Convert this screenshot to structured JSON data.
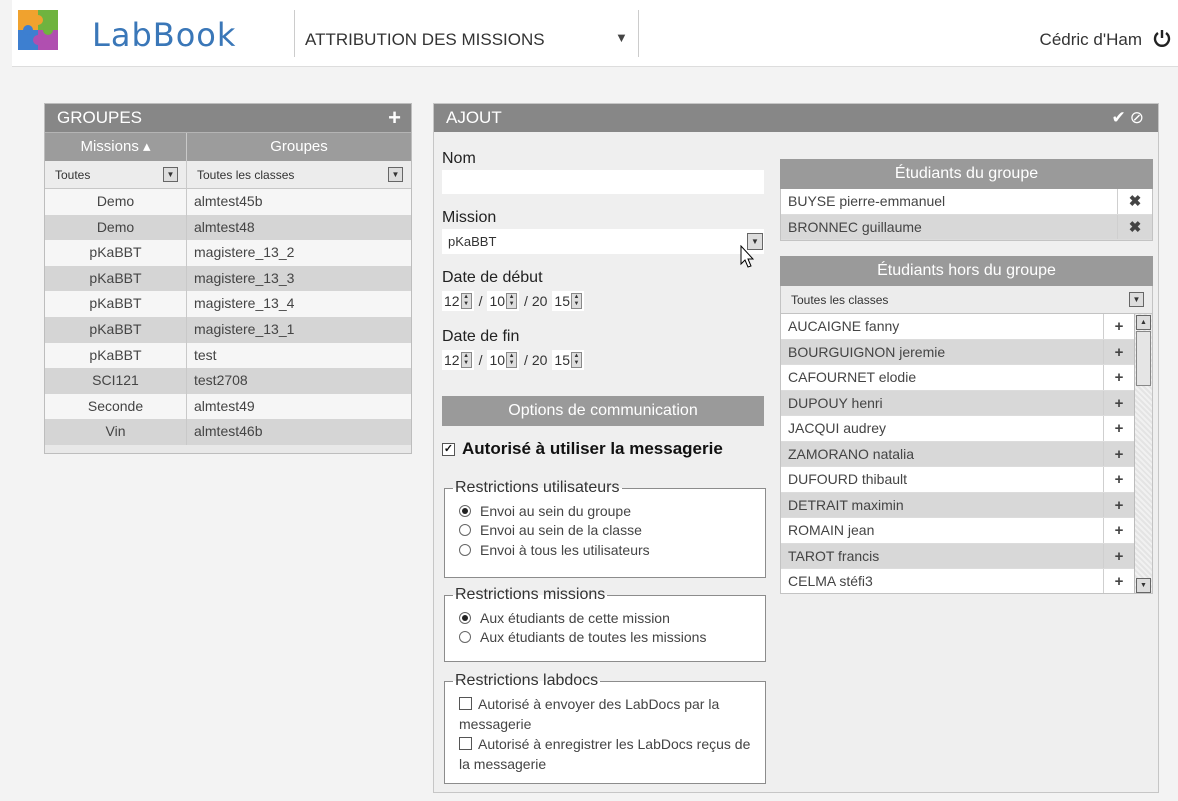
{
  "header": {
    "logo_text": "LabBook",
    "menu_title": "ATTRIBUTION DES MISSIONS",
    "username": "Cédric d'Ham"
  },
  "groups": {
    "title": "GROUPES",
    "col_missions": "Missions ▴",
    "col_groups": "Groupes",
    "filter_missions": "Toutes",
    "filter_groups": "Toutes les classes",
    "rows": [
      {
        "mission": "Demo",
        "group": "almtest45b"
      },
      {
        "mission": "Demo",
        "group": "almtest48"
      },
      {
        "mission": "pKaBBT",
        "group": "magistere_13_2"
      },
      {
        "mission": "pKaBBT",
        "group": "magistere_13_3"
      },
      {
        "mission": "pKaBBT",
        "group": "magistere_13_4"
      },
      {
        "mission": "pKaBBT",
        "group": "magistere_13_1"
      },
      {
        "mission": "pKaBBT",
        "group": "test"
      },
      {
        "mission": "SCI121",
        "group": "test2708"
      },
      {
        "mission": "Seconde",
        "group": "almtest49"
      },
      {
        "mission": "Vin",
        "group": "almtest46b"
      }
    ]
  },
  "ajout": {
    "title": "AJOUT",
    "nom_label": "Nom",
    "nom_value": "",
    "mission_label": "Mission",
    "mission_value": "pKaBBT",
    "start_label": "Date de début",
    "start": {
      "day": "12",
      "month": "10",
      "century": "/ 20",
      "year": "15"
    },
    "end_label": "Date de fin",
    "end": {
      "day": "12",
      "month": "10",
      "century": "/ 20",
      "year": "15"
    },
    "options_title": "Options de communication",
    "messaging_label": "Autorisé à utiliser la messagerie",
    "restr_users": {
      "legend": "Restrictions utilisateurs",
      "opts": [
        "Envoi au sein du groupe",
        "Envoi au sein de la classe",
        "Envoi à tous les utilisateurs"
      ]
    },
    "restr_missions": {
      "legend": "Restrictions missions",
      "opts": [
        "Aux étudiants de cette mission",
        "Aux étudiants de toutes les missions"
      ]
    },
    "restr_labdocs": {
      "legend": "Restrictions labdocs",
      "opt1": "Autorisé à envoyer des LabDocs par la messagerie",
      "opt2": "Autorisé à enregistrer les LabDocs reçus de la messagerie"
    },
    "in_group": {
      "title": "Étudiants du groupe",
      "students": [
        "BUYSE pierre-emmanuel",
        "BRONNEC guillaume"
      ]
    },
    "out_group": {
      "title": "Étudiants hors du groupe",
      "filter": "Toutes les classes",
      "students": [
        "AUCAIGNE fanny",
        "BOURGUIGNON jeremie",
        "CAFOURNET elodie",
        "DUPOUY henri",
        "JACQUI audrey",
        "ZAMORANO natalia",
        "DUFOURD thibault",
        "DETRAIT maximin",
        "ROMAIN jean",
        "TAROT francis",
        "CELMA stéfi3"
      ]
    }
  },
  "colors": {
    "header_bg": "#878787",
    "subheader_bg": "#9a9a9a",
    "logo_blue": "#3a77b8"
  },
  "icons": {
    "add": "plus-icon",
    "validate": "check-icon",
    "cancel": "cancel-icon",
    "remove": "close-icon",
    "power": "power-icon"
  }
}
